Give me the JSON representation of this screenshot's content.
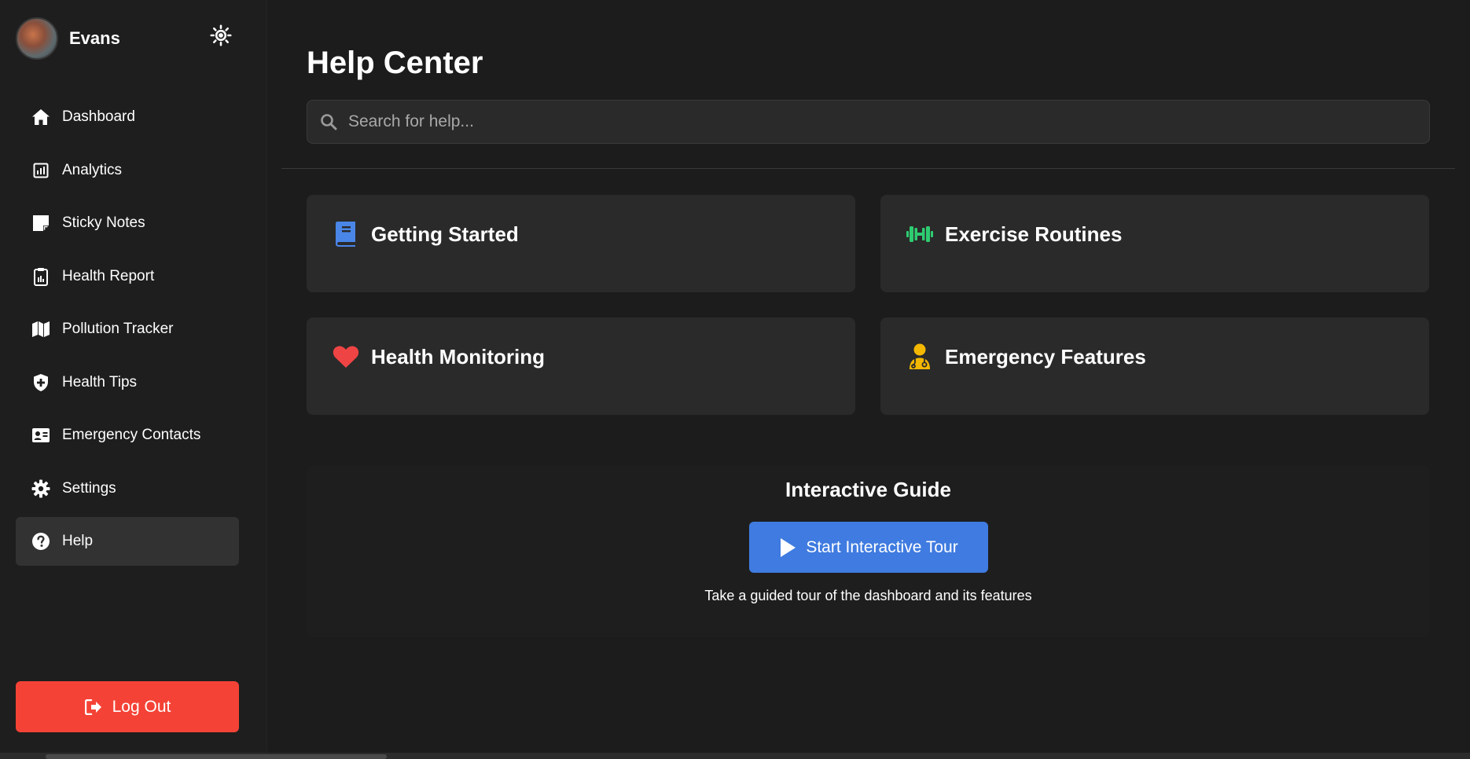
{
  "profile": {
    "name": "Evans"
  },
  "sidebar": {
    "items": [
      {
        "label": "Dashboard",
        "icon": "home-icon"
      },
      {
        "label": "Analytics",
        "icon": "chart-icon"
      },
      {
        "label": "Sticky Notes",
        "icon": "sticky-note-icon"
      },
      {
        "label": "Health Report",
        "icon": "clipboard-icon"
      },
      {
        "label": "Pollution Tracker",
        "icon": "map-icon"
      },
      {
        "label": "Health Tips",
        "icon": "shield-plus-icon"
      },
      {
        "label": "Emergency Contacts",
        "icon": "contact-card-icon"
      },
      {
        "label": "Settings",
        "icon": "gear-icon"
      },
      {
        "label": "Help",
        "icon": "question-circle-icon",
        "active": true
      }
    ],
    "logout_label": "Log Out"
  },
  "main": {
    "title": "Help Center",
    "search": {
      "placeholder": "Search for help..."
    },
    "cards": [
      {
        "title": "Getting Started",
        "icon": "book-icon",
        "color": "#4a86e8"
      },
      {
        "title": "Exercise Routines",
        "icon": "dumbbell-icon",
        "color": "#2ecc71"
      },
      {
        "title": "Health Monitoring",
        "icon": "heart-icon",
        "color": "#ef4444"
      },
      {
        "title": "Emergency Features",
        "icon": "doctor-icon",
        "color": "#f5b800"
      }
    ],
    "guide": {
      "title": "Interactive Guide",
      "button_label": "Start Interactive Tour",
      "description": "Take a guided tour of the dashboard and its features"
    }
  },
  "colors": {
    "background": "#1c1c1c",
    "card": "#2a2a2a",
    "accent": "#3f7be0",
    "danger": "#f44336"
  }
}
